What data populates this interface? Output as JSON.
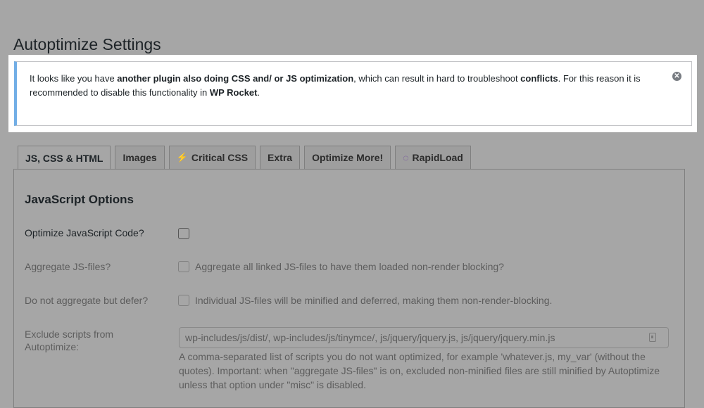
{
  "page": {
    "title": "Autoptimize Settings"
  },
  "notice": {
    "p1": "It looks like you have ",
    "b1": "another plugin also doing CSS and/ or JS optimization",
    "p2": ", which can result in hard to troubleshoot ",
    "b2": "conflicts",
    "p3": ". For this reason it is recommended to disable this functionality in ",
    "b3": "WP Rocket",
    "p4": ".",
    "dismiss_icon": "close-icon"
  },
  "tabs": [
    {
      "label": "JS, CSS & HTML",
      "active": true
    },
    {
      "label": "Images"
    },
    {
      "label": "Critical CSS",
      "icon": "lightning-icon"
    },
    {
      "label": "Extra"
    },
    {
      "label": "Optimize More!"
    },
    {
      "label": "RapidLoad",
      "icon": "rapidload-icon"
    }
  ],
  "js_options": {
    "heading": "JavaScript Options",
    "optimize": {
      "label": "Optimize JavaScript Code?",
      "checked": false
    },
    "aggregate": {
      "label": "Aggregate JS-files?",
      "description": "Aggregate all linked JS-files to have them loaded non-render blocking?",
      "checked": false
    },
    "defer": {
      "label": "Do not aggregate but defer?",
      "description": "Individual JS-files will be minified and deferred, making them non-render-blocking.",
      "checked": false
    },
    "exclude": {
      "label_line1": "Exclude scripts from",
      "label_line2": "Autoptimize:",
      "value": "wp-includes/js/dist/, wp-includes/js/tinymce/, js/jquery/jquery.js, js/jquery/jquery.min.js",
      "help": "A comma-separated list of scripts you do not want optimized, for example 'whatever.js, my_var' (without the quotes). Important: when \"aggregate JS-files\" is on, excluded non-minified files are still minified by Autoptimize unless that option under \"misc\" is disabled."
    }
  }
}
